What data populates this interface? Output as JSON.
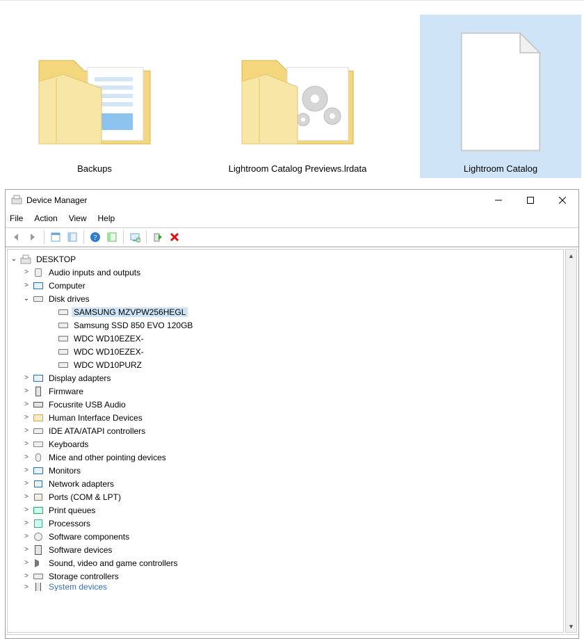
{
  "explorer": {
    "items": [
      {
        "label": "Backups",
        "type": "folder-with-files",
        "selected": false
      },
      {
        "label": "Lightroom Catalog Previews.lrdata",
        "type": "folder-with-gears",
        "selected": false
      },
      {
        "label": "Lightroom Catalog",
        "type": "file-blank",
        "selected": true
      }
    ]
  },
  "deviceManager": {
    "title": "Device Manager",
    "menu": [
      "File",
      "Action",
      "View",
      "Help"
    ],
    "toolbar": [
      {
        "name": "back",
        "glyph": "arrow-left"
      },
      {
        "name": "forward",
        "glyph": "arrow-right"
      },
      {
        "sep": true
      },
      {
        "name": "show-hidden",
        "glyph": "panel"
      },
      {
        "name": "refresh",
        "glyph": "panel-blue"
      },
      {
        "sep": true
      },
      {
        "name": "help",
        "glyph": "help"
      },
      {
        "name": "action",
        "glyph": "panel-green"
      },
      {
        "sep": true
      },
      {
        "name": "scan",
        "glyph": "monitor-scan"
      },
      {
        "sep": true
      },
      {
        "name": "enable",
        "glyph": "enable-green"
      },
      {
        "name": "disable",
        "glyph": "disable-red"
      }
    ],
    "rootLabel": "DESKTOP",
    "tree": [
      {
        "label": "Audio inputs and outputs",
        "icon": "speaker",
        "state": "collapsed"
      },
      {
        "label": "Computer",
        "icon": "monitor",
        "state": "collapsed"
      },
      {
        "label": "Disk drives",
        "icon": "drive",
        "state": "expanded",
        "children": [
          {
            "label": "SAMSUNG MZVPW256HEGL",
            "icon": "drive",
            "selected": true
          },
          {
            "label": "Samsung SSD 850 EVO 120GB",
            "icon": "drive"
          },
          {
            "label": "WDC WD10EZEX-",
            "icon": "drive"
          },
          {
            "label": "WDC WD10EZEX-",
            "icon": "drive"
          },
          {
            "label": "WDC WD10PURZ",
            "icon": "drive"
          }
        ]
      },
      {
        "label": "Display adapters",
        "icon": "monitor",
        "state": "collapsed"
      },
      {
        "label": "Firmware",
        "icon": "tower",
        "state": "collapsed"
      },
      {
        "label": "Focusrite USB Audio",
        "icon": "usb",
        "state": "collapsed"
      },
      {
        "label": "Human Interface Devices",
        "icon": "hid",
        "state": "collapsed"
      },
      {
        "label": "IDE ATA/ATAPI controllers",
        "icon": "drive",
        "state": "collapsed"
      },
      {
        "label": "Keyboards",
        "icon": "keyboard",
        "state": "collapsed"
      },
      {
        "label": "Mice and other pointing devices",
        "icon": "mouse",
        "state": "collapsed"
      },
      {
        "label": "Monitors",
        "icon": "monitor",
        "state": "collapsed"
      },
      {
        "label": "Network adapters",
        "icon": "net",
        "state": "collapsed"
      },
      {
        "label": "Ports (COM & LPT)",
        "icon": "port",
        "state": "collapsed"
      },
      {
        "label": "Print queues",
        "icon": "printer",
        "state": "collapsed"
      },
      {
        "label": "Processors",
        "icon": "chip",
        "state": "collapsed"
      },
      {
        "label": "Software components",
        "icon": "gear",
        "state": "collapsed"
      },
      {
        "label": "Software devices",
        "icon": "dev",
        "state": "collapsed"
      },
      {
        "label": "Sound, video and game controllers",
        "icon": "snd",
        "state": "collapsed"
      },
      {
        "label": "Storage controllers",
        "icon": "drive",
        "state": "collapsed"
      },
      {
        "label": "System devices",
        "icon": "tower",
        "state": "collapsed",
        "cut": true
      }
    ]
  }
}
